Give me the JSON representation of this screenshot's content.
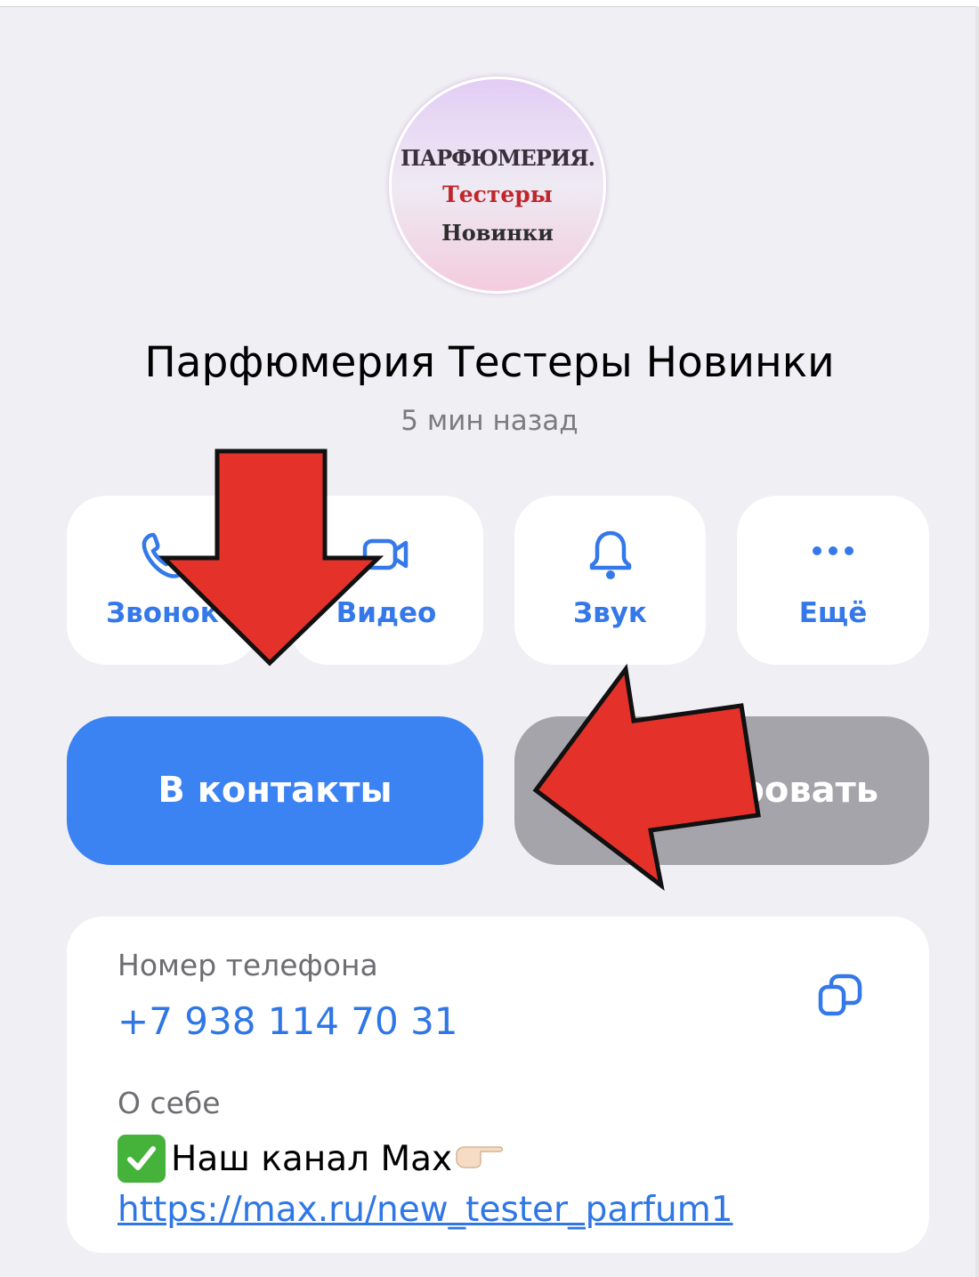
{
  "avatar": {
    "line1": "ПАРФЮМЕРИЯ.",
    "line2": "Тестеры",
    "line3": "Новинки"
  },
  "profile": {
    "name": "Парфюмерия Тестеры Новинки",
    "last_seen": "5 мин назад"
  },
  "actions": [
    {
      "label": "Звонок",
      "icon": "phone-icon"
    },
    {
      "label": "Видео",
      "icon": "video-camera-icon"
    },
    {
      "label": "Звук",
      "icon": "bell-icon"
    },
    {
      "label": "Ещё",
      "icon": "more-dots-icon"
    }
  ],
  "buttons": {
    "add_contact": "В контакты",
    "block": "Заблокировать"
  },
  "info": {
    "phone_label": "Номер телефона",
    "phone_value": "+7 938 114 70 31",
    "about_label": "О себе",
    "about_text": "Наш канал Max",
    "about_link": "https://max.ru/new_tester_parfum1"
  },
  "colors": {
    "accent": "#3478e9",
    "primary_button": "#3b82f2",
    "secondary_button": "#a4a4aa",
    "background": "#efeff4",
    "annotation_arrow": "#e4322b"
  }
}
